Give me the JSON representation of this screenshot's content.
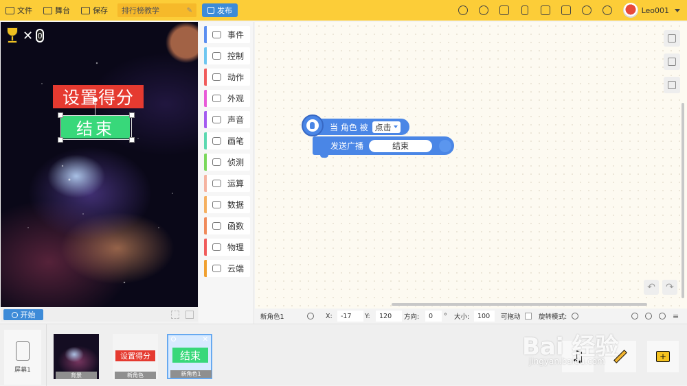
{
  "toolbar": {
    "file_label": "文件",
    "stage_label": "舞台",
    "save_label": "保存",
    "project_name": "排行榜教学",
    "publish_label": "发布",
    "username": "Leo001"
  },
  "stage": {
    "score_times": "✕",
    "score_value": "0",
    "sprite_red_text": "设置得分",
    "sprite_green_text": "结束",
    "start_label": "开始"
  },
  "categories": [
    {
      "label": "事件",
      "color": "#5b8ef0"
    },
    {
      "label": "控制",
      "color": "#6ec6f0"
    },
    {
      "label": "动作",
      "color": "#f05b5b"
    },
    {
      "label": "外观",
      "color": "#e85ad8"
    },
    {
      "label": "声音",
      "color": "#a45bf0"
    },
    {
      "label": "画笔",
      "color": "#5bd8b0"
    },
    {
      "label": "侦测",
      "color": "#7ad85b"
    },
    {
      "label": "运算",
      "color": "#f5b3a0"
    },
    {
      "label": "数据",
      "color": "#f5b060"
    },
    {
      "label": "函数",
      "color": "#f08a5b"
    },
    {
      "label": "物理",
      "color": "#f05b5b"
    },
    {
      "label": "云端",
      "color": "#f0a030"
    }
  ],
  "blocks": {
    "hat_text": "当 角色 被",
    "hat_dropdown": "点击",
    "broadcast_text": "发送广播",
    "broadcast_value": "结束"
  },
  "props": {
    "sprite_name": "新角色1",
    "x_label": "X:",
    "x_value": "-17",
    "y_label": "Y:",
    "y_value": "120",
    "dir_label": "方向:",
    "dir_value": "0",
    "dir_unit": "°",
    "size_label": "大小:",
    "size_value": "100",
    "drag_label": "可拖动",
    "rotate_label": "旋转模式:"
  },
  "bottom": {
    "screen_label": "屏幕1",
    "thumbs": [
      {
        "label": "背景",
        "text": ""
      },
      {
        "label": "新角色",
        "text": "设置得分"
      },
      {
        "label": "新角色1",
        "text": "结束"
      }
    ]
  },
  "watermark": {
    "main": "Bai 经验",
    "sub": "jingyan.baidu.com"
  },
  "colors": {
    "topbar": "#fccd38",
    "accent": "#3d8bd8",
    "block_blue": "#4a86e6",
    "workspace": "#fdfaf1"
  }
}
